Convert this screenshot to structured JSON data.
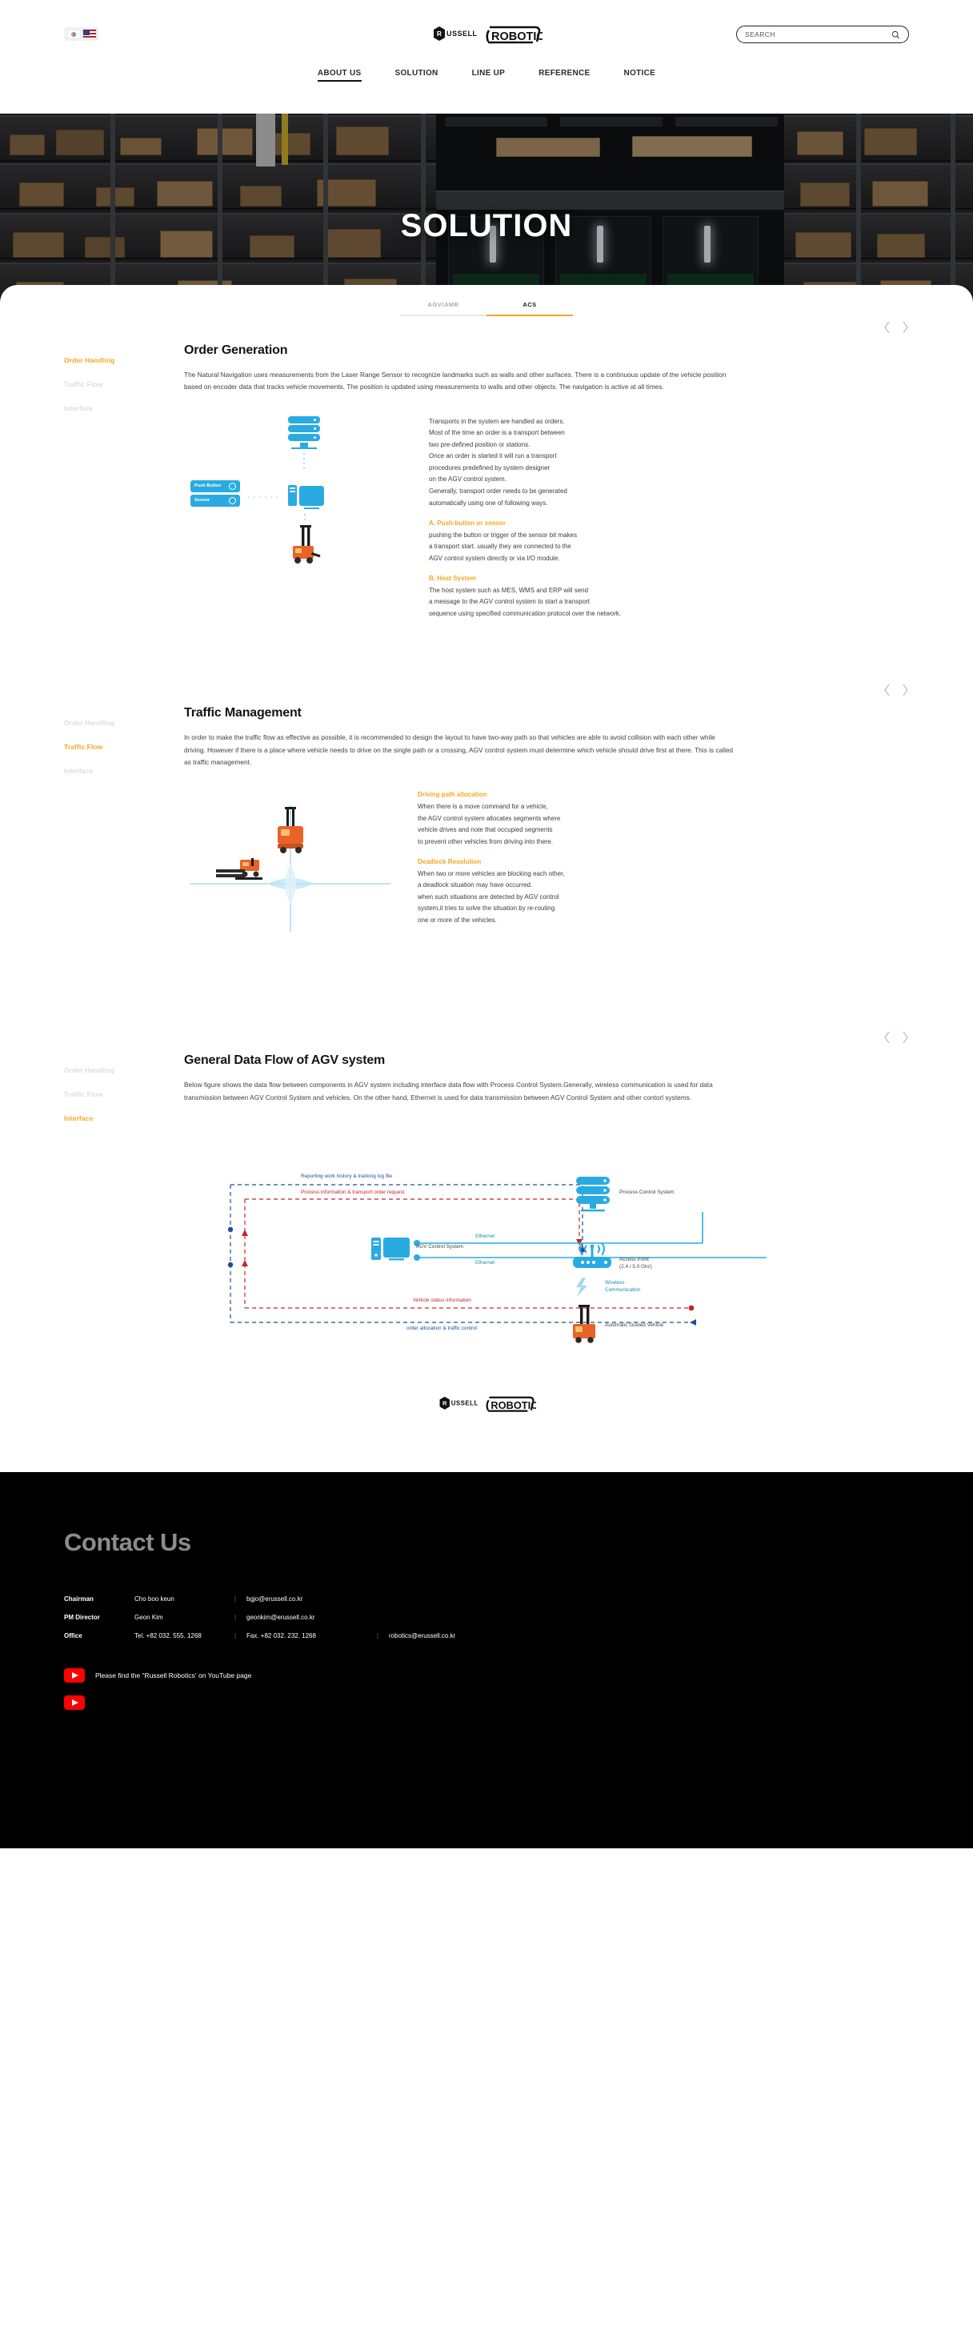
{
  "brand": {
    "mark": "RUSSELL",
    "name": "ROBOTICS"
  },
  "header": {
    "lang": {
      "kr_icon": "flag-kr-icon",
      "us_icon": "flag-us-icon"
    },
    "search": {
      "placeholder": "SEARCH",
      "value": "",
      "icon": "search-icon"
    },
    "nav": [
      {
        "label": "ABOUT US",
        "active": true
      },
      {
        "label": "SOLUTION",
        "active": false
      },
      {
        "label": "LINE UP",
        "active": false
      },
      {
        "label": "REFERENCE",
        "active": false
      },
      {
        "label": "NOTICE",
        "active": false
      }
    ]
  },
  "hero": {
    "title": "SOLUTION"
  },
  "tabs": [
    {
      "label": "AGV/AMR",
      "active": false
    },
    {
      "label": "ACS",
      "active": true
    }
  ],
  "side_nav": [
    "Order Handling",
    "Traffic Flow",
    "Interface"
  ],
  "arrows": {
    "prev": "‹",
    "next": "›"
  },
  "section1": {
    "active_nav": "Order Handling",
    "title": "Order Generation",
    "desc": "The Natural Navigation uses measurements from the Laser Range Sensor to recognize landmarks such as walls and other surfaces. There is a continuous update of the vehicle position based on encoder data that tracks vehicle movements. The position is updated using measurements to walls and other objects. The navigation is active at all times.",
    "diagram": {
      "push_button": "Push Button",
      "sensor": "Sensor",
      "server_icon": "server-icon",
      "pc_icon": "computer-icon",
      "agv_icon": "agv-forklift-icon"
    },
    "body": "Transports in the system are handled as orders.\nMost of the time an order is a transport between\ntwo pre-defined position or stations.\nOnce an order is started it will run a transport\nprocedures predefined by system designer\non the AGV control system.\nGenerally, transport order needs to be generated\nautomatically using one of following ways.",
    "item_a_title": "A. Push-button or sensor",
    "item_a_body": "pushing the button or trigger of the sensor bit makes\na transport start. usually they are connected to the\nAGV control system directly or via I/O module.",
    "item_b_title": "B. Host System",
    "item_b_body": "The host system such as MES, WMS and ERP will send\na message to the AGV control system to start a transport\nsequence using specified communication protocol over the network."
  },
  "section2": {
    "active_nav": "Traffic Flow",
    "title": "Traffic Management",
    "desc": "In order to make the traffic flow as effective as possible, it is recommended to design the layout to have two-way path so that vehicles are able to avoid collision with each other while driving. However if there is a place where vehicle needs to drive on the single path or a crossing, AGV control system must determine which vehicle should drive first at there. This is called as traffic management.",
    "item_a_title": "Driving path allocation",
    "item_a_body": "When there is a move command for a vehicle,\nthe AGV control system allocates segments where\nvehicle drives and note that occupied segments\nto prevent other vehicles from driving into there.",
    "item_b_title": "Deadlock Resolution",
    "item_b_body": "When two or more vehicles are blocking each other,\na deadlock situation may have occurred.\nwhen such situations are detected by AGV control\nsystem,it tries to solve the situation by re-routing\none or more of the vehicles."
  },
  "section3": {
    "active_nav": "Interface",
    "title": "General Data Flow of AGV system",
    "desc": "Below figure shows the data flow between components in AGV system including interface data flow with Process Control System.Generally, wireless communication is used for data transmission between AGV Control System and vehicles. On the other hand, Ethernet is used for data transmission between AGV Control System and other contorl systems.",
    "flow": {
      "label_reporting": "Reporting work history & tracking log file",
      "label_process_info": "Process information & transport order request",
      "label_ethernet_1": "Ethernet",
      "label_ethernet_2": "Ethernet",
      "label_vehicle_status": "Vehicle status information",
      "label_order_alloc": "order allocation & traffic control",
      "node_pcs": "Process Control System",
      "node_acs": "AGV Control System",
      "node_ap": "Access Point\n(2.4 / 5.0 Ghz)",
      "node_wireless": "Wireless\nCommunication",
      "node_agv": "Automatic Guided Vehicle"
    }
  },
  "footer": {
    "heading": "Contact Us",
    "rows": [
      {
        "role": "Chairman",
        "name": "Cho boo keun",
        "c1": "bgjo@erussell.co.kr",
        "c2": ""
      },
      {
        "role": "PM Director",
        "name": "Geon Kim",
        "c1": "geonkim@erussell.co.kr",
        "c2": ""
      },
      {
        "role": "Office",
        "name": "Tel. +82 032. 555. 1268",
        "c1": "Fax. +82 032. 232. 1268",
        "c2": "robotics@erussell.co.kr"
      }
    ],
    "youtube": {
      "icon": "youtube-icon",
      "text": "Please find the “Russell Robotics‘ on YouTube page"
    }
  },
  "colors": {
    "accent": "#f5a623",
    "cyan": "#29abe2",
    "blue": "#1f4e96",
    "red": "#c0272d",
    "orange_agv": "#e8622a",
    "footer_bg": "#000000",
    "youtube_red": "#ff0000"
  }
}
